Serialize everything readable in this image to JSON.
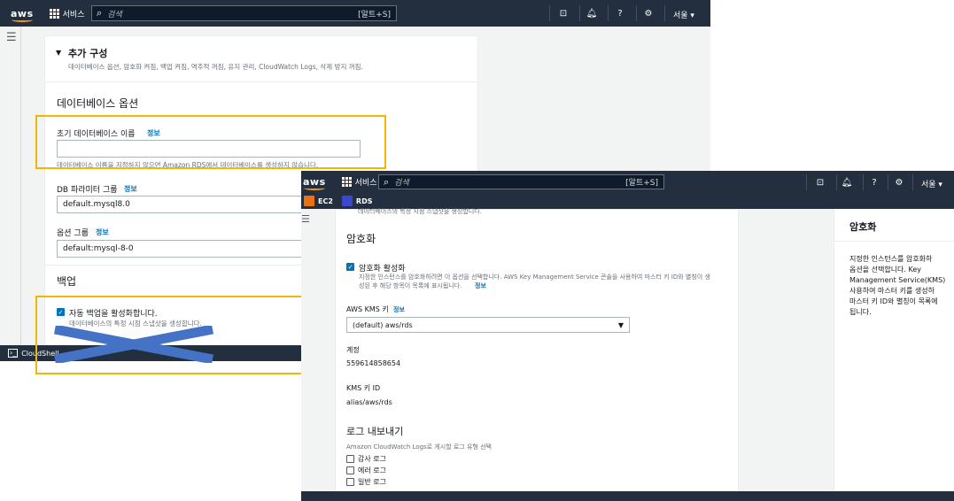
{
  "back": {
    "topbar": {
      "logo": "aws",
      "services": "서비스",
      "search_placeholder": "검색",
      "search_shortcut": "[알트+S]",
      "region": "서울 ▾"
    },
    "additional_config": {
      "title": "추가 구성",
      "caret": "▼",
      "subtitle": "데이터베이스 옵션, 암호화 켜짐, 백업 켜짐, 역추적 꺼짐, 유지 관리, CloudWatch Logs, 삭제 방지 꺼짐."
    },
    "database_options": {
      "heading": "데이터베이스 옵션",
      "initial_db_name_label": "초기 데이터베이스 이름",
      "info": "정보",
      "initial_db_name_value": "",
      "initial_db_name_help": "데이터베이스 이름을 지정하지 않으면 Amazon RDS에서 데이터베이스를 생성하지 않습니다.",
      "param_group_label": "DB 파라미터 그룹",
      "param_group_value": "default.mysql8.0",
      "option_group_label": "옵션 그룹",
      "option_group_value": "default:mysql-8-0"
    },
    "backup": {
      "heading": "백업",
      "auto_backup_label": "자동 백업을 활성화합니다.",
      "auto_backup_desc": "데이터베이스의 특정 시점 스냅샷을 생성합니다."
    },
    "cloudshell": "CloudShell"
  },
  "front": {
    "topbar": {
      "logo": "aws",
      "services": "서비스",
      "search_placeholder": "검색",
      "search_shortcut": "[알트+S]",
      "region": "서울 ▾"
    },
    "favorites": [
      {
        "label": "EC2",
        "color": "#ec7211"
      },
      {
        "label": "RDS",
        "color": "#3b48cc"
      }
    ],
    "cut_text": "데이터베이스의 특정 시점 스냅샷을 생성합니다.",
    "encryption": {
      "heading": "암호화",
      "enable_label": "암호화 활성화",
      "enable_desc_1": "지정한 인스턴스를 암호화하려면 이 옵션을 선택합니다. AWS Key Management Service 콘솔을 사용하여 마스터 키 ID와 별칭이 생",
      "enable_desc_2": "성된 후 해당 항목이 목록에 표시됩니다.",
      "info": "정보",
      "kms_key_label": "AWS KMS 키",
      "kms_key_value": "(default) aws/rds",
      "account_label": "계정",
      "account_value": "559614858654",
      "kms_id_label": "KMS 키 ID",
      "kms_id_value": "alias/aws/rds"
    },
    "log_export": {
      "heading": "로그 내보내기",
      "desc": "Amazon CloudWatch Logs로 게시할 로그 유형 선택",
      "items": [
        "감사 로그",
        "에러 로그",
        "일반 로그"
      ]
    },
    "help_panel": {
      "title": "암호화",
      "body": [
        "지정한 인스턴스를 암호화하",
        "옵션을 선택합니다. Key",
        "Management Service(KMS) ",
        "사용하여 마스터 키를 생성하",
        "마스터 키 ID와 별칭이 목록에",
        "됩니다."
      ]
    }
  },
  "colors": {
    "nav": "#232f3e",
    "highlight": "#f2b705",
    "link": "#0073bb",
    "cross": "#4472c4"
  }
}
